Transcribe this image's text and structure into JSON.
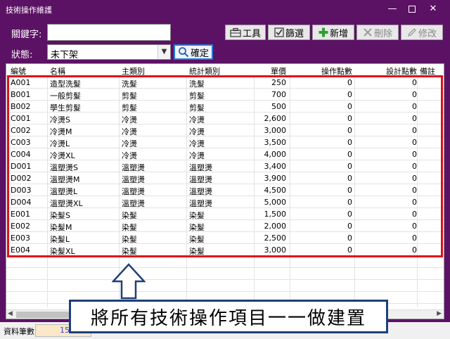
{
  "window": {
    "title": "技術操作維護",
    "min_glyph": "—",
    "close_glyph": "✕"
  },
  "filters": {
    "keyword_label": "關鍵字:",
    "keyword_value": "",
    "status_label": "狀態:",
    "status_value": "未下架",
    "confirm_label": "確定"
  },
  "toolbar": {
    "tools_label": "工具",
    "filter_label": "篩選",
    "add_label": "新增",
    "delete_label": "刪除",
    "edit_label": "修改"
  },
  "table": {
    "columns": [
      "編號",
      "名稱",
      "主類別",
      "統計類別",
      "單價",
      "操作點數",
      "設計點數",
      "備註"
    ],
    "rows": [
      [
        "A001",
        "造型洗髮",
        "洗髮",
        "洗髮",
        "250",
        "0",
        "0"
      ],
      [
        "B001",
        "一般剪髮",
        "剪髮",
        "剪髮",
        "700",
        "0",
        "0"
      ],
      [
        "B002",
        "學生剪髮",
        "剪髮",
        "剪髮",
        "500",
        "0",
        "0"
      ],
      [
        "C001",
        "冷燙S",
        "冷燙",
        "冷燙",
        "2,600",
        "0",
        "0"
      ],
      [
        "C002",
        "冷燙M",
        "冷燙",
        "冷燙",
        "3,000",
        "0",
        "0"
      ],
      [
        "C003",
        "冷燙L",
        "冷燙",
        "冷燙",
        "3,500",
        "0",
        "0"
      ],
      [
        "C004",
        "冷燙XL",
        "冷燙",
        "冷燙",
        "4,000",
        "0",
        "0"
      ],
      [
        "D001",
        "溫塑燙S",
        "溫塑燙",
        "溫塑燙",
        "3,400",
        "0",
        "0"
      ],
      [
        "D002",
        "溫塑燙M",
        "溫塑燙",
        "溫塑燙",
        "3,900",
        "0",
        "0"
      ],
      [
        "D003",
        "溫塑燙L",
        "溫塑燙",
        "溫塑燙",
        "4,500",
        "0",
        "0"
      ],
      [
        "D004",
        "溫塑燙XL",
        "溫塑燙",
        "溫塑燙",
        "5,000",
        "0",
        "0"
      ],
      [
        "E001",
        "染髮S",
        "染髮",
        "染髮",
        "1,500",
        "0",
        "0"
      ],
      [
        "E002",
        "染髮M",
        "染髮",
        "染髮",
        "2,000",
        "0",
        "0"
      ],
      [
        "E003",
        "染髮L",
        "染髮",
        "染髮",
        "2,500",
        "0",
        "0"
      ],
      [
        "E004",
        "染髮XL",
        "染髮",
        "染髮",
        "3,000",
        "0",
        "0"
      ]
    ]
  },
  "statusbar": {
    "count_label": "資料筆數:",
    "count_value": "15"
  },
  "annotation": {
    "text": "將所有技術操作項目一一做建置"
  },
  "colors": {
    "window_bg": "#5c1264",
    "highlight_border": "#e0101a",
    "callout_border": "#1f3f7a",
    "count_bg": "#fde7c9",
    "add_icon": "#2fa02f"
  }
}
